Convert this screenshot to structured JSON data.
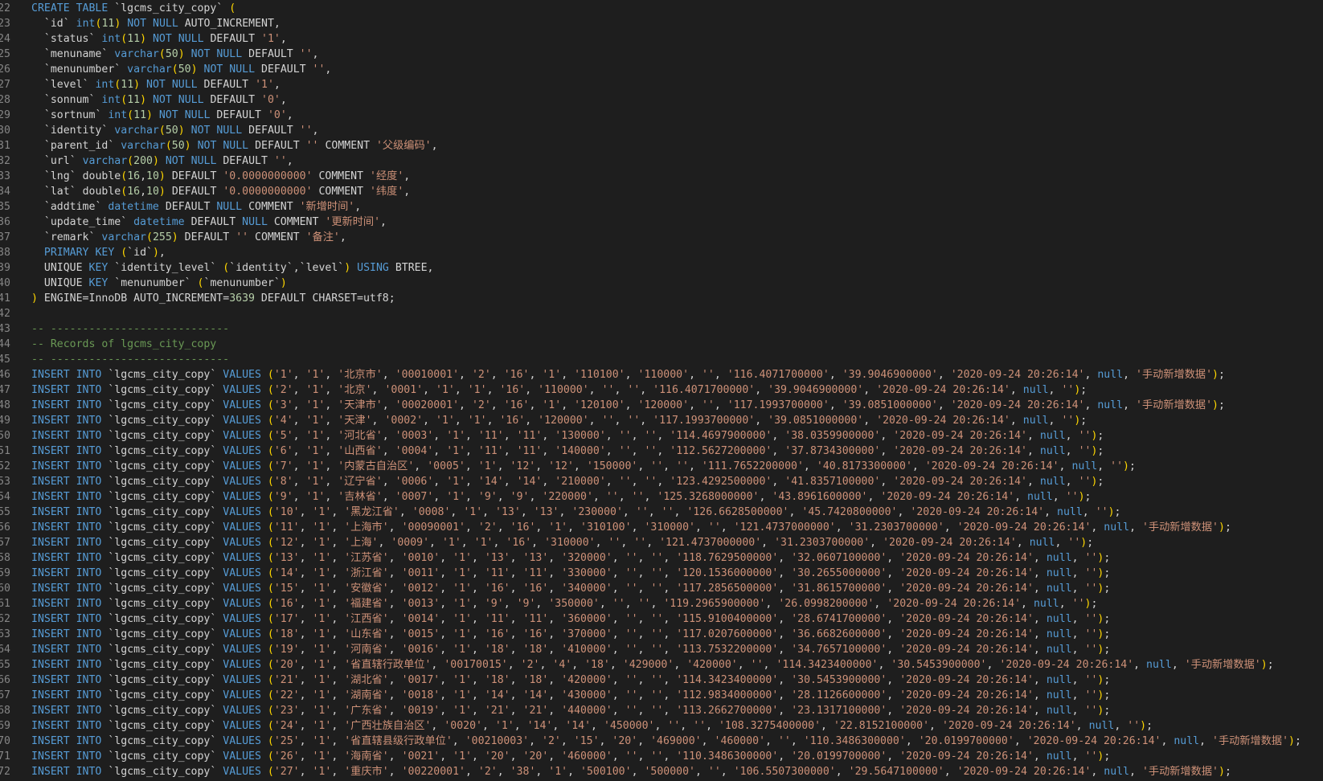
{
  "editor": {
    "language": "sql",
    "colors": {
      "background": "#1e1e1e",
      "keyword": "#569cd6",
      "string": "#ce9178",
      "number": "#b5cea8",
      "comment": "#6a9955",
      "text": "#d4d4d4",
      "gutter": "#858585",
      "paren": "#ffd700"
    },
    "lines": [
      {
        "n": "22",
        "t": "CREATE TABLE `lgcms_city_copy` ("
      },
      {
        "n": "23",
        "t": "  `id` int(11) NOT NULL AUTO_INCREMENT,"
      },
      {
        "n": "24",
        "t": "  `status` int(11) NOT NULL DEFAULT '1',"
      },
      {
        "n": "25",
        "t": "  `menuname` varchar(50) NOT NULL DEFAULT '',"
      },
      {
        "n": "26",
        "t": "  `menunumber` varchar(50) NOT NULL DEFAULT '',"
      },
      {
        "n": "27",
        "t": "  `level` int(11) NOT NULL DEFAULT '1',"
      },
      {
        "n": "28",
        "t": "  `sonnum` int(11) NOT NULL DEFAULT '0',"
      },
      {
        "n": "29",
        "t": "  `sortnum` int(11) NOT NULL DEFAULT '0',"
      },
      {
        "n": "30",
        "t": "  `identity` varchar(50) NOT NULL DEFAULT '',"
      },
      {
        "n": "31",
        "t": "  `parent_id` varchar(50) NOT NULL DEFAULT '' COMMENT '父级编码',"
      },
      {
        "n": "32",
        "t": "  `url` varchar(200) NOT NULL DEFAULT '',"
      },
      {
        "n": "33",
        "t": "  `lng` double(16,10) DEFAULT '0.0000000000' COMMENT '经度',"
      },
      {
        "n": "34",
        "t": "  `lat` double(16,10) DEFAULT '0.0000000000' COMMENT '纬度',"
      },
      {
        "n": "35",
        "t": "  `addtime` datetime DEFAULT NULL COMMENT '新增时间',"
      },
      {
        "n": "36",
        "t": "  `update_time` datetime DEFAULT NULL COMMENT '更新时间',"
      },
      {
        "n": "37",
        "t": "  `remark` varchar(255) DEFAULT '' COMMENT '备注',"
      },
      {
        "n": "38",
        "t": "  PRIMARY KEY (`id`),"
      },
      {
        "n": "39",
        "t": "  UNIQUE KEY `identity_level` (`identity`,`level`) USING BTREE,"
      },
      {
        "n": "40",
        "t": "  UNIQUE KEY `menunumber` (`menunumber`)"
      },
      {
        "n": "41",
        "t": ") ENGINE=InnoDB AUTO_INCREMENT=3639 DEFAULT CHARSET=utf8;"
      },
      {
        "n": "42",
        "t": ""
      },
      {
        "n": "43",
        "t": "-- ----------------------------"
      },
      {
        "n": "44",
        "t": "-- Records of lgcms_city_copy"
      },
      {
        "n": "45",
        "t": "-- ----------------------------"
      },
      {
        "n": "46",
        "t": "INSERT INTO `lgcms_city_copy` VALUES ('1', '1', '北京市', '00010001', '2', '16', '1', '110100', '110000', '', '116.4071700000', '39.9046900000', '2020-09-24 20:26:14', null, '手动新增数据');"
      },
      {
        "n": "47",
        "t": "INSERT INTO `lgcms_city_copy` VALUES ('2', '1', '北京', '0001', '1', '1', '16', '110000', '', '', '116.4071700000', '39.9046900000', '2020-09-24 20:26:14', null, '');"
      },
      {
        "n": "48",
        "t": "INSERT INTO `lgcms_city_copy` VALUES ('3', '1', '天津市', '00020001', '2', '16', '1', '120100', '120000', '', '117.1993700000', '39.0851000000', '2020-09-24 20:26:14', null, '手动新增数据');"
      },
      {
        "n": "49",
        "t": "INSERT INTO `lgcms_city_copy` VALUES ('4', '1', '天津', '0002', '1', '1', '16', '120000', '', '', '117.1993700000', '39.0851000000', '2020-09-24 20:26:14', null, '');"
      },
      {
        "n": "50",
        "t": "INSERT INTO `lgcms_city_copy` VALUES ('5', '1', '河北省', '0003', '1', '11', '11', '130000', '', '', '114.4697900000', '38.0359900000', '2020-09-24 20:26:14', null, '');"
      },
      {
        "n": "51",
        "t": "INSERT INTO `lgcms_city_copy` VALUES ('6', '1', '山西省', '0004', '1', '11', '11', '140000', '', '', '112.5627200000', '37.8734300000', '2020-09-24 20:26:14', null, '');"
      },
      {
        "n": "52",
        "t": "INSERT INTO `lgcms_city_copy` VALUES ('7', '1', '内蒙古自治区', '0005', '1', '12', '12', '150000', '', '', '111.7652200000', '40.8173300000', '2020-09-24 20:26:14', null, '');"
      },
      {
        "n": "53",
        "t": "INSERT INTO `lgcms_city_copy` VALUES ('8', '1', '辽宁省', '0006', '1', '14', '14', '210000', '', '', '123.4292500000', '41.8357100000', '2020-09-24 20:26:14', null, '');"
      },
      {
        "n": "54",
        "t": "INSERT INTO `lgcms_city_copy` VALUES ('9', '1', '吉林省', '0007', '1', '9', '9', '220000', '', '', '125.3268000000', '43.8961600000', '2020-09-24 20:26:14', null, '');"
      },
      {
        "n": "55",
        "t": "INSERT INTO `lgcms_city_copy` VALUES ('10', '1', '黑龙江省', '0008', '1', '13', '13', '230000', '', '', '126.6628500000', '45.7420800000', '2020-09-24 20:26:14', null, '');"
      },
      {
        "n": "56",
        "t": "INSERT INTO `lgcms_city_copy` VALUES ('11', '1', '上海市', '00090001', '2', '16', '1', '310100', '310000', '', '121.4737000000', '31.2303700000', '2020-09-24 20:26:14', null, '手动新增数据');"
      },
      {
        "n": "57",
        "t": "INSERT INTO `lgcms_city_copy` VALUES ('12', '1', '上海', '0009', '1', '1', '16', '310000', '', '', '121.4737000000', '31.2303700000', '2020-09-24 20:26:14', null, '');"
      },
      {
        "n": "58",
        "t": "INSERT INTO `lgcms_city_copy` VALUES ('13', '1', '江苏省', '0010', '1', '13', '13', '320000', '', '', '118.7629500000', '32.0607100000', '2020-09-24 20:26:14', null, '');"
      },
      {
        "n": "59",
        "t": "INSERT INTO `lgcms_city_copy` VALUES ('14', '1', '浙江省', '0011', '1', '11', '11', '330000', '', '', '120.1536000000', '30.2655000000', '2020-09-24 20:26:14', null, '');"
      },
      {
        "n": "60",
        "t": "INSERT INTO `lgcms_city_copy` VALUES ('15', '1', '安徽省', '0012', '1', '16', '16', '340000', '', '', '117.2856500000', '31.8615700000', '2020-09-24 20:26:14', null, '');"
      },
      {
        "n": "61",
        "t": "INSERT INTO `lgcms_city_copy` VALUES ('16', '1', '福建省', '0013', '1', '9', '9', '350000', '', '', '119.2965900000', '26.0998200000', '2020-09-24 20:26:14', null, '');"
      },
      {
        "n": "62",
        "t": "INSERT INTO `lgcms_city_copy` VALUES ('17', '1', '江西省', '0014', '1', '11', '11', '360000', '', '', '115.9100400000', '28.6741700000', '2020-09-24 20:26:14', null, '');"
      },
      {
        "n": "63",
        "t": "INSERT INTO `lgcms_city_copy` VALUES ('18', '1', '山东省', '0015', '1', '16', '16', '370000', '', '', '117.0207600000', '36.6682600000', '2020-09-24 20:26:14', null, '');"
      },
      {
        "n": "64",
        "t": "INSERT INTO `lgcms_city_copy` VALUES ('19', '1', '河南省', '0016', '1', '18', '18', '410000', '', '', '113.7532200000', '34.7657100000', '2020-09-24 20:26:14', null, '');"
      },
      {
        "n": "65",
        "t": "INSERT INTO `lgcms_city_copy` VALUES ('20', '1', '省直辖行政单位', '00170015', '2', '4', '18', '429000', '420000', '', '114.3423400000', '30.5453900000', '2020-09-24 20:26:14', null, '手动新增数据');"
      },
      {
        "n": "66",
        "t": "INSERT INTO `lgcms_city_copy` VALUES ('21', '1', '湖北省', '0017', '1', '18', '18', '420000', '', '', '114.3423400000', '30.5453900000', '2020-09-24 20:26:14', null, '');"
      },
      {
        "n": "67",
        "t": "INSERT INTO `lgcms_city_copy` VALUES ('22', '1', '湖南省', '0018', '1', '14', '14', '430000', '', '', '112.9834000000', '28.1126600000', '2020-09-24 20:26:14', null, '');"
      },
      {
        "n": "68",
        "t": "INSERT INTO `lgcms_city_copy` VALUES ('23', '1', '广东省', '0019', '1', '21', '21', '440000', '', '', '113.2662700000', '23.1317100000', '2020-09-24 20:26:14', null, '');"
      },
      {
        "n": "69",
        "t": "INSERT INTO `lgcms_city_copy` VALUES ('24', '1', '广西壮族自治区', '0020', '1', '14', '14', '450000', '', '', '108.3275400000', '22.8152100000', '2020-09-24 20:26:14', null, '');"
      },
      {
        "n": "70",
        "t": "INSERT INTO `lgcms_city_copy` VALUES ('25', '1', '省直辖县级行政单位', '00210003', '2', '15', '20', '469000', '460000', '', '110.3486300000', '20.0199700000', '2020-09-24 20:26:14', null, '手动新增数据');"
      },
      {
        "n": "71",
        "t": "INSERT INTO `lgcms_city_copy` VALUES ('26', '1', '海南省', '0021', '1', '20', '20', '460000', '', '', '110.3486300000', '20.0199700000', '2020-09-24 20:26:14', null, '');"
      },
      {
        "n": "72",
        "t": "INSERT INTO `lgcms_city_copy` VALUES ('27', '1', '重庆市', '00220001', '2', '38', '1', '500100', '500000', '', '106.5507300000', '29.5647100000', '2020-09-24 20:26:14', null, '手动新增数据');"
      }
    ]
  }
}
